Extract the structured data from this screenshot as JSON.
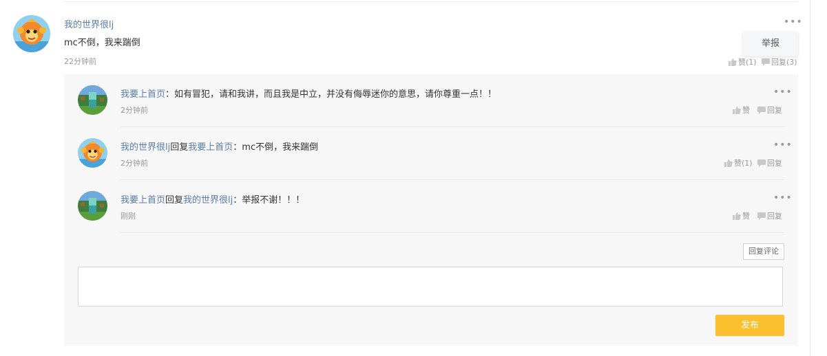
{
  "comment": {
    "username": "我的世界很lj",
    "text": "mc不倒，我来踹倒",
    "time": "22分钟前",
    "like_label": "赞(1)",
    "reply_label": "回复(3)",
    "report_label": "举报",
    "more_glyph": "•••"
  },
  "replies": [
    {
      "user": "我要上首页",
      "reply_word": "",
      "target": "",
      "sep": "：",
      "text": "如有冒犯，请和我讲，而且我是中立，并没有侮辱迷你的意思，请你尊重一点！！",
      "time": "2分钟前",
      "like_label": "赞",
      "reply_label": "回复"
    },
    {
      "user": "我的世界很lj",
      "reply_word": "回复",
      "target": "我要上首页",
      "sep": "：",
      "text": "mc不倒，我来踹倒",
      "time": "2分钟前",
      "like_label": "赞(1)",
      "reply_label": "回复"
    },
    {
      "user": "我要上首页",
      "reply_word": "回复",
      "target": "我的世界很lj",
      "sep": "：",
      "text": "举报不谢！！！",
      "time": "刚刚",
      "like_label": "赞",
      "reply_label": "回复"
    }
  ],
  "composer": {
    "reply_comment_label": "回复评论",
    "input_value": "",
    "publish_label": "发布"
  },
  "colors": {
    "link": "#5b7dab",
    "publish": "#fcc02e",
    "panel_bg": "#f7f7f7"
  },
  "icons": [
    "thumbs-up-icon",
    "chat-bubble-icon",
    "more-dots-icon"
  ]
}
